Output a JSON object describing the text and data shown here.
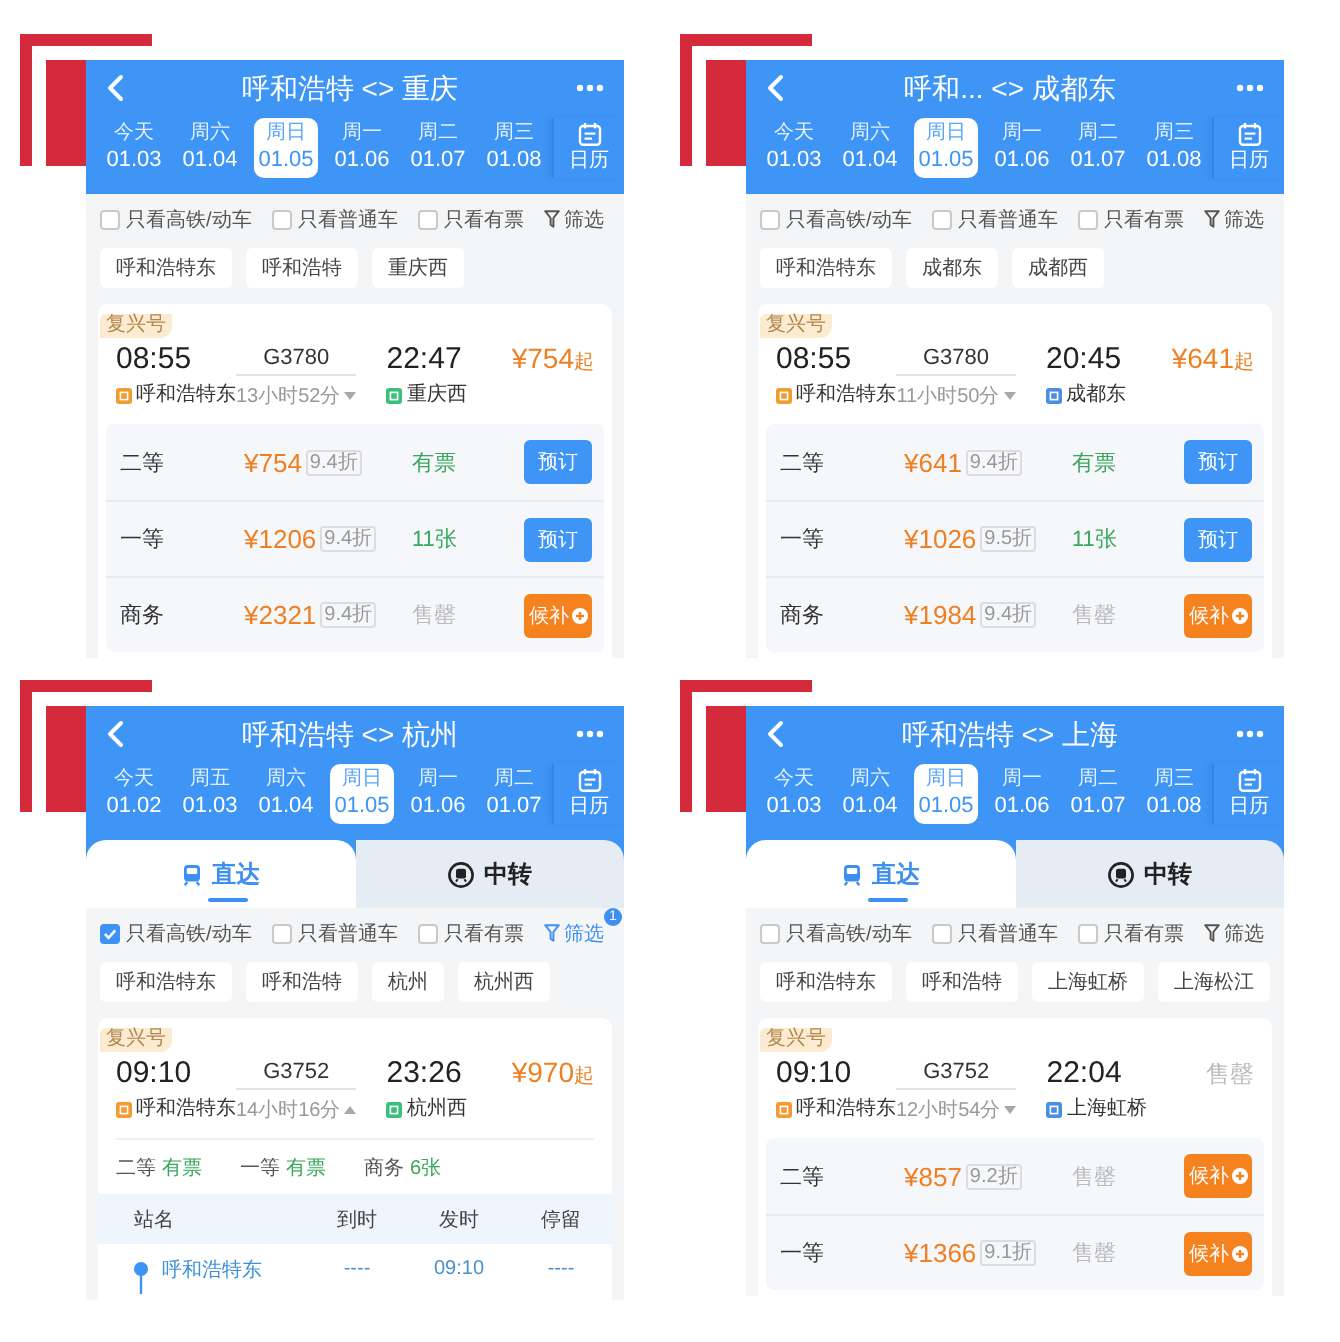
{
  "panels": [
    {
      "title": "呼和浩特 <> 重庆",
      "dates": [
        {
          "weekday": "今天",
          "date": "01.03",
          "selected": false
        },
        {
          "weekday": "周六",
          "date": "01.04",
          "selected": false
        },
        {
          "weekday": "周日",
          "date": "01.05",
          "selected": true
        },
        {
          "weekday": "周一",
          "date": "01.06",
          "selected": false
        },
        {
          "weekday": "周二",
          "date": "01.07",
          "selected": false
        },
        {
          "weekday": "周三",
          "date": "01.08",
          "selected": false
        }
      ],
      "calendar": "日历",
      "filters": [
        {
          "label": "只看高铁/动车",
          "checked": false
        },
        {
          "label": "只看普通车",
          "checked": false
        },
        {
          "label": "只看有票",
          "checked": false
        }
      ],
      "filter_button": {
        "label": "筛选",
        "active": false
      },
      "stations": [
        "呼和浩特东",
        "呼和浩特",
        "重庆西"
      ],
      "train": {
        "tag": "复兴号",
        "depart_time": "08:55",
        "number": "G3780",
        "arrive_time": "22:47",
        "price": "¥754",
        "price_suffix": "起",
        "from": {
          "name": "呼和浩特东",
          "color": "#f39a30"
        },
        "duration": "13小时52分",
        "expanded": false,
        "to": {
          "name": "重庆西",
          "color": "#3cbf7a"
        },
        "seats": [
          {
            "class": "二等",
            "price": "¥754",
            "discount": "9.4折",
            "availability": "有票",
            "available": true,
            "action": {
              "kind": "book",
              "label": "预订"
            }
          },
          {
            "class": "一等",
            "price": "¥1206",
            "discount": "9.4折",
            "availability": "11张",
            "available": true,
            "action": {
              "kind": "book",
              "label": "预订"
            }
          },
          {
            "class": "商务",
            "price": "¥2321",
            "discount": "9.4折",
            "availability": "售罄",
            "available": false,
            "action": {
              "kind": "waitlist",
              "label": "候补"
            }
          }
        ]
      }
    },
    {
      "title": "呼和... <> 成都东",
      "dates": [
        {
          "weekday": "今天",
          "date": "01.03",
          "selected": false
        },
        {
          "weekday": "周六",
          "date": "01.04",
          "selected": false
        },
        {
          "weekday": "周日",
          "date": "01.05",
          "selected": true
        },
        {
          "weekday": "周一",
          "date": "01.06",
          "selected": false
        },
        {
          "weekday": "周二",
          "date": "01.07",
          "selected": false
        },
        {
          "weekday": "周三",
          "date": "01.08",
          "selected": false
        }
      ],
      "calendar": "日历",
      "filters": [
        {
          "label": "只看高铁/动车",
          "checked": false
        },
        {
          "label": "只看普通车",
          "checked": false
        },
        {
          "label": "只看有票",
          "checked": false
        }
      ],
      "filter_button": {
        "label": "筛选",
        "active": false
      },
      "stations": [
        "呼和浩特东",
        "成都东",
        "成都西"
      ],
      "train": {
        "tag": "复兴号",
        "depart_time": "08:55",
        "number": "G3780",
        "arrive_time": "20:45",
        "price": "¥641",
        "price_suffix": "起",
        "from": {
          "name": "呼和浩特东",
          "color": "#f39a30"
        },
        "duration": "11小时50分",
        "expanded": false,
        "to": {
          "name": "成都东",
          "color": "#4a90e2"
        },
        "seats": [
          {
            "class": "二等",
            "price": "¥641",
            "discount": "9.4折",
            "availability": "有票",
            "available": true,
            "action": {
              "kind": "book",
              "label": "预订"
            }
          },
          {
            "class": "一等",
            "price": "¥1026",
            "discount": "9.5折",
            "availability": "11张",
            "available": true,
            "action": {
              "kind": "book",
              "label": "预订"
            }
          },
          {
            "class": "商务",
            "price": "¥1984",
            "discount": "9.4折",
            "availability": "售罄",
            "available": false,
            "action": {
              "kind": "waitlist",
              "label": "候补"
            }
          }
        ]
      }
    },
    {
      "title": "呼和浩特 <> 杭州",
      "dates": [
        {
          "weekday": "今天",
          "date": "01.02",
          "selected": false
        },
        {
          "weekday": "周五",
          "date": "01.03",
          "selected": false
        },
        {
          "weekday": "周六",
          "date": "01.04",
          "selected": false
        },
        {
          "weekday": "周日",
          "date": "01.05",
          "selected": true
        },
        {
          "weekday": "周一",
          "date": "01.06",
          "selected": false
        },
        {
          "weekday": "周二",
          "date": "01.07",
          "selected": false
        }
      ],
      "calendar": "日历",
      "tabs": [
        {
          "kind": "direct",
          "label": "直达",
          "selected": true
        },
        {
          "kind": "transfer",
          "label": "中转",
          "selected": false
        }
      ],
      "filters": [
        {
          "label": "只看高铁/动车",
          "checked": true
        },
        {
          "label": "只看普通车",
          "checked": false
        },
        {
          "label": "只看有票",
          "checked": false
        }
      ],
      "filter_button": {
        "label": "筛选",
        "active": true,
        "badge": "1"
      },
      "stations": [
        "呼和浩特东",
        "呼和浩特",
        "杭州",
        "杭州西"
      ],
      "train": {
        "tag": "复兴号",
        "depart_time": "09:10",
        "number": "G3752",
        "arrive_time": "23:26",
        "price": "¥970",
        "price_suffix": "起",
        "from": {
          "name": "呼和浩特东",
          "color": "#f39a30"
        },
        "duration": "14小时16分",
        "expanded": true,
        "to": {
          "name": "杭州西",
          "color": "#3cbf7a"
        },
        "summary": [
          {
            "class": "二等",
            "availability": "有票",
            "available": true
          },
          {
            "class": "一等",
            "availability": "有票",
            "available": true
          },
          {
            "class": "商务",
            "availability": "6张",
            "available": true
          }
        ],
        "stops": {
          "columns": [
            "站名",
            "到时",
            "发时",
            "停留"
          ],
          "rows": [
            {
              "station": "呼和浩特东",
              "arrive": "----",
              "depart": "09:10",
              "stay": "----"
            }
          ]
        }
      }
    },
    {
      "title": "呼和浩特 <> 上海",
      "dates": [
        {
          "weekday": "今天",
          "date": "01.03",
          "selected": false
        },
        {
          "weekday": "周六",
          "date": "01.04",
          "selected": false
        },
        {
          "weekday": "周日",
          "date": "01.05",
          "selected": true
        },
        {
          "weekday": "周一",
          "date": "01.06",
          "selected": false
        },
        {
          "weekday": "周二",
          "date": "01.07",
          "selected": false
        },
        {
          "weekday": "周三",
          "date": "01.08",
          "selected": false
        }
      ],
      "calendar": "日历",
      "tabs": [
        {
          "kind": "direct",
          "label": "直达",
          "selected": true
        },
        {
          "kind": "transfer",
          "label": "中转",
          "selected": false
        }
      ],
      "filters": [
        {
          "label": "只看高铁/动车",
          "checked": false
        },
        {
          "label": "只看普通车",
          "checked": false
        },
        {
          "label": "只看有票",
          "checked": false
        }
      ],
      "filter_button": {
        "label": "筛选",
        "active": false
      },
      "stations": [
        "呼和浩特东",
        "呼和浩特",
        "上海虹桥",
        "上海松江"
      ],
      "train": {
        "tag": "复兴号",
        "depart_time": "09:10",
        "number": "G3752",
        "arrive_time": "22:04",
        "status": "售罄",
        "from": {
          "name": "呼和浩特东",
          "color": "#f39a30"
        },
        "duration": "12小时54分",
        "expanded": false,
        "to": {
          "name": "上海虹桥",
          "color": "#4a90e2"
        },
        "seats": [
          {
            "class": "二等",
            "price": "¥857",
            "discount": "9.2折",
            "availability": "售罄",
            "available": false,
            "action": {
              "kind": "waitlist",
              "label": "候补"
            }
          },
          {
            "class": "一等",
            "price": "¥1366",
            "discount": "9.1折",
            "availability": "售罄",
            "available": false,
            "action": {
              "kind": "waitlist",
              "label": "候补"
            }
          }
        ]
      }
    }
  ]
}
